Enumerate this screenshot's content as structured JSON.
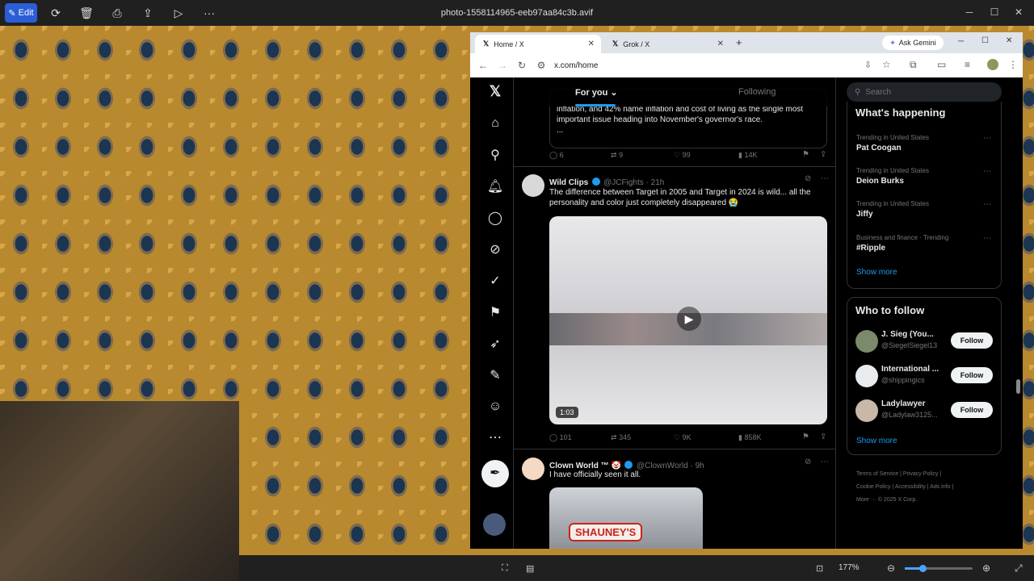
{
  "viewer": {
    "edit_label": "Edit",
    "file_title": "photo-1558114965-eeb97aa84c3b.avif",
    "zoom": "177%"
  },
  "browser": {
    "tabs": [
      {
        "label": "Home / X"
      },
      {
        "label": "Grok / X"
      }
    ],
    "ask_gemini": "Ask Gemini",
    "url": "x.com/home"
  },
  "feed": {
    "tab_foryou": "For you",
    "tab_following": "Following",
    "post0": {
      "text": "inflation, and 42% name inflation and cost of living as the single most important issue heading into November's governor's race.",
      "ellipsis": "...",
      "replies": "6",
      "reposts": "9",
      "likes": "99",
      "views": "14K"
    },
    "post1": {
      "name": "Wild Clips",
      "handle": "@JCFights · 21h",
      "text": "The difference between Target in 2005 and Target in 2024 is wild... all the personality and color just completely disappeared 😭",
      "duration": "1:03",
      "replies": "101",
      "reposts": "345",
      "likes": "9K",
      "views": "858K"
    },
    "post2": {
      "name": "Clown World ™ 🤡",
      "handle": "@ClownWorld · 9h",
      "text": "I have officially seen it all.",
      "sign": "SHAUNEY'S"
    }
  },
  "sidebar": {
    "search_placeholder": "Search",
    "whats_happening": "What's happening",
    "trends": [
      {
        "context": "Trending in United States",
        "name": "Pat Coogan"
      },
      {
        "context": "Trending in United States",
        "name": "Deion Burks"
      },
      {
        "context": "Trending in United States",
        "name": "Jiffy"
      },
      {
        "context": "Business and finance · Trending",
        "name": "#Ripple"
      }
    ],
    "show_more": "Show more",
    "who_to_follow": "Who to follow",
    "follow_label": "Follow",
    "who": [
      {
        "name": "J. Sieg (You...",
        "handle": "@SiegelSiegel13"
      },
      {
        "name": "International ...",
        "handle": "@shippingics"
      },
      {
        "name": "Ladylawyer",
        "handle": "@Ladylaw3125..."
      }
    ],
    "footer_line1": "Terms of Service  |  Privacy Policy  |",
    "footer_line2": "Cookie Policy  |  Accessibility  |  Ads info  |",
    "footer_line3": "More ···  © 2025 X Corp."
  }
}
